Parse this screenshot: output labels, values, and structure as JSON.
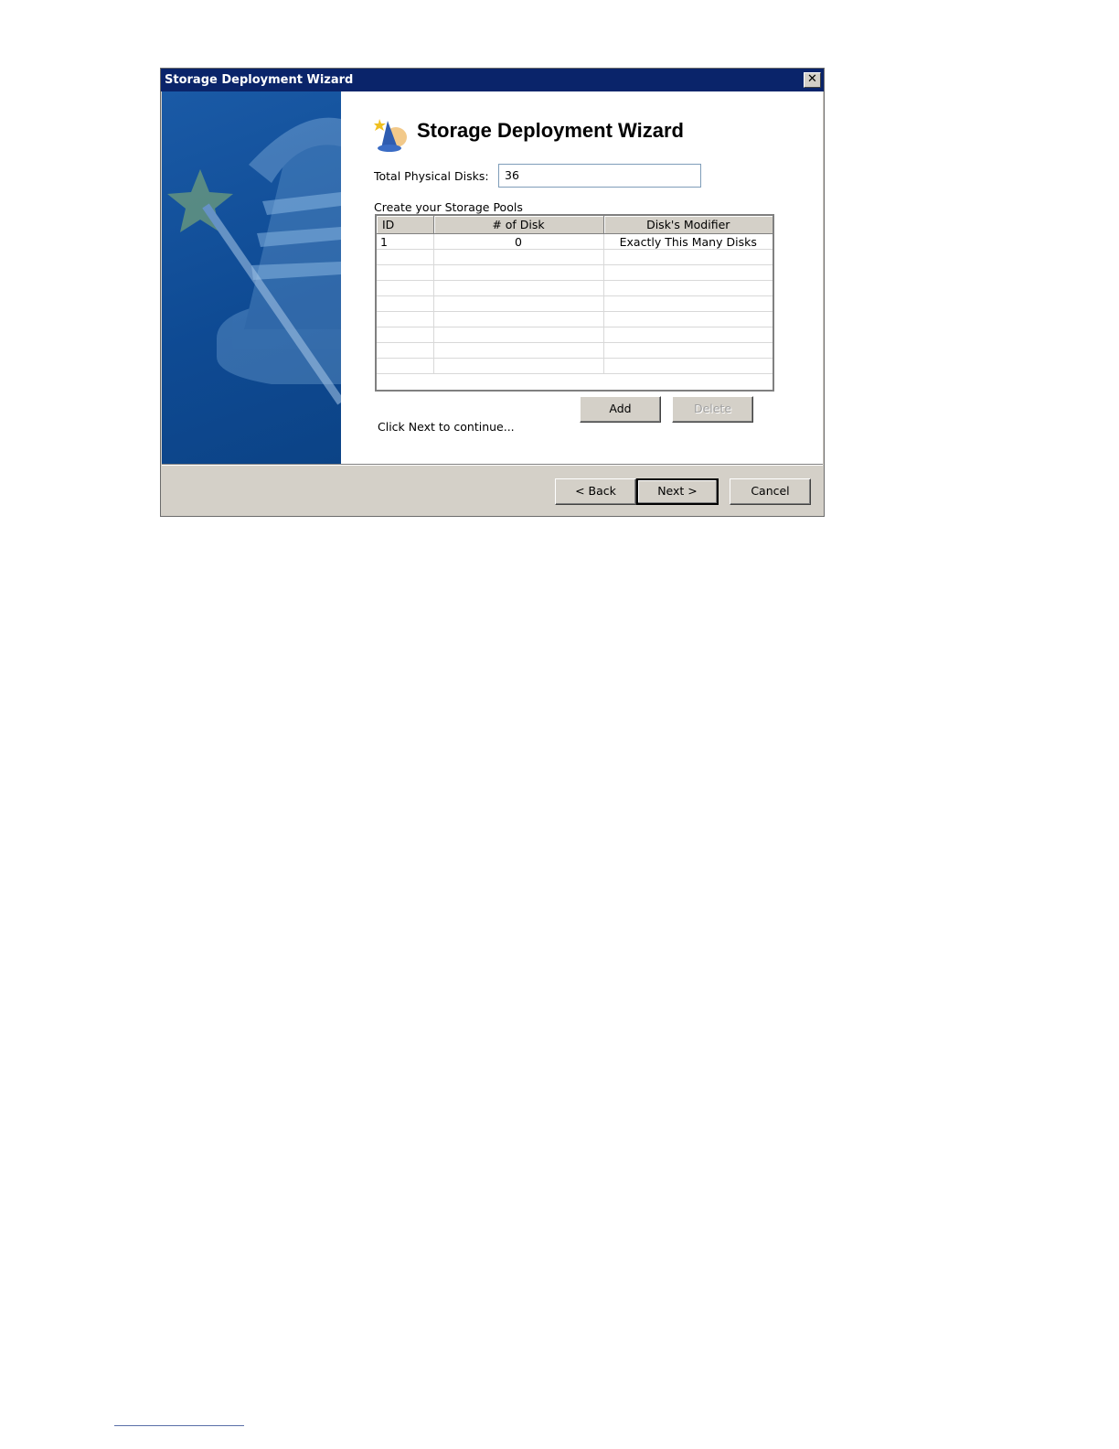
{
  "window": {
    "title": "Storage Deployment Wizard",
    "close_glyph": "✕",
    "colors": {
      "titlebar": "#0a246a",
      "banner": "#1a5aa6",
      "face": "#d4d0c8"
    }
  },
  "header": {
    "heading": "Storage Deployment Wizard",
    "icon": "wizard-hat-icon"
  },
  "form": {
    "total_disks_label": "Total Physical Disks:",
    "total_disks_value": "36",
    "pools_label": "Create your Storage Pools"
  },
  "pools_table": {
    "columns": [
      "ID",
      "# of Disk",
      "Disk's Modifier"
    ],
    "rows": [
      {
        "id": "1",
        "disks": "0",
        "modifier": "Exactly This Many Disks"
      }
    ]
  },
  "actions": {
    "add_label": "Add",
    "delete_label": "Delete"
  },
  "status_text": "Click Next to continue...",
  "footer": {
    "back_label": "< Back",
    "next_label": "Next >",
    "cancel_label": "Cancel"
  }
}
